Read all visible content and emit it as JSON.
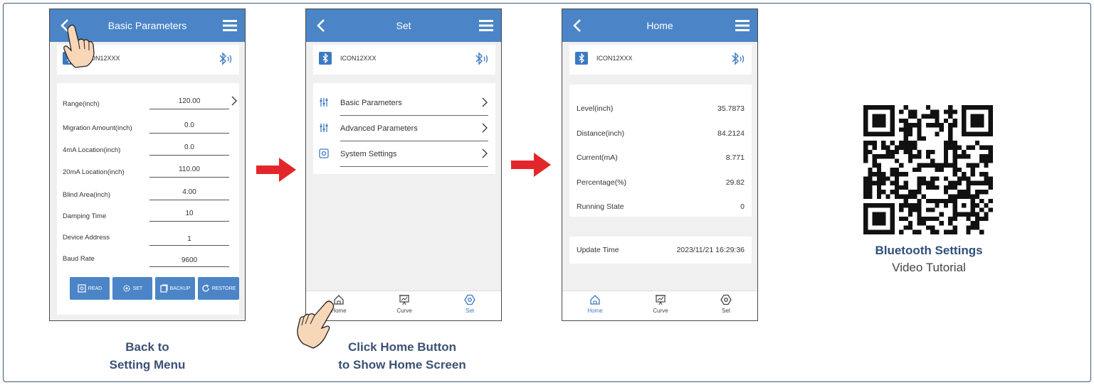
{
  "colors": {
    "accent": "#4b85c7",
    "arrow": "#e3262b",
    "caption": "#3b5175"
  },
  "phone1": {
    "title": "Basic Parameters",
    "device": "ICON12XXX",
    "params": [
      {
        "label": "Range(inch)",
        "value": "120.00"
      },
      {
        "label": "Migration Amount(inch)",
        "value": "0.0"
      },
      {
        "label": "4mA Location(inch)",
        "value": "0.0"
      },
      {
        "label": "20mA Location(inch)",
        "value": "110.00"
      },
      {
        "label": "Blind Area(inch)",
        "value": "4.00"
      },
      {
        "label": "Damping Time",
        "value": "10"
      },
      {
        "label": "Device Address",
        "value": "1"
      },
      {
        "label": "Baud Rate",
        "value": "9600"
      }
    ],
    "buttons": {
      "read": "READ",
      "set": "SET",
      "backup": "BACKUP",
      "restore": "RESTORE"
    }
  },
  "phone2": {
    "title": "Set",
    "device": "ICON12XXX",
    "menu": [
      {
        "label": "Basic Parameters",
        "icon": "sliders-icon"
      },
      {
        "label": "Advanced Parameters",
        "icon": "sliders-icon"
      },
      {
        "label": "System Settings",
        "icon": "settings-icon"
      }
    ],
    "nav": {
      "home": "Home",
      "curve": "Curve",
      "set": "Set"
    }
  },
  "phone3": {
    "title": "Home",
    "device": "ICON12XXX",
    "readings": [
      {
        "label": "Level(inch)",
        "value": "35.7873"
      },
      {
        "label": "Distance(inch)",
        "value": "84.2124"
      },
      {
        "label": "Current(mA)",
        "value": "8.771"
      },
      {
        "label": "Percentage(%)",
        "value": "29.82"
      },
      {
        "label": "Running State",
        "value": "0"
      }
    ],
    "update_label": "Update Time",
    "update_value": "2023/11/21 16:29:36",
    "nav": {
      "home": "Home",
      "curve": "Curve",
      "set": "Set"
    }
  },
  "captions": {
    "c1_line1": "Back to",
    "c1_line2": "Setting Menu",
    "c2_line1": "Click Home Button",
    "c2_line2": "to Show Home Screen"
  },
  "qr": {
    "title": "Bluetooth Settings",
    "subtitle": "Video Tutorial"
  }
}
